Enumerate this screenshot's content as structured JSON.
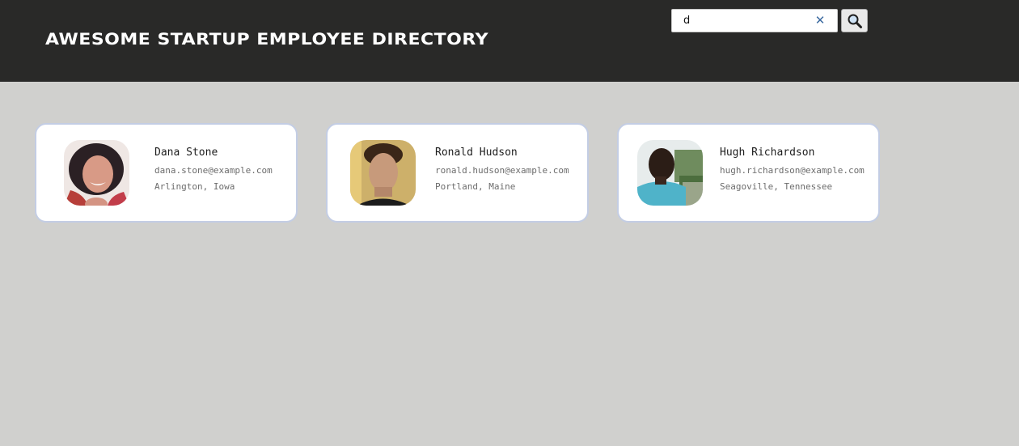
{
  "header": {
    "title": "Awesome Startup Employee Directory",
    "background": "#292928"
  },
  "search": {
    "value": "d",
    "clear_glyph": "✕",
    "clear_icon": "close-icon",
    "submit_icon": "magnifying-glass-icon"
  },
  "employees": [
    {
      "name": "Dana Stone",
      "email": "dana.stone@example.com",
      "location": "Arlington, Iowa"
    },
    {
      "name": "Ronald Hudson",
      "email": "ronald.hudson@example.com",
      "location": "Portland, Maine"
    },
    {
      "name": "Hugh Richardson",
      "email": "hugh.richardson@example.com",
      "location": "Seagoville, Tennessee"
    }
  ],
  "colors": {
    "page_background": "#d0d0ce",
    "card_border": "#c3cde4",
    "clear_icon": "#3b6aa0"
  }
}
